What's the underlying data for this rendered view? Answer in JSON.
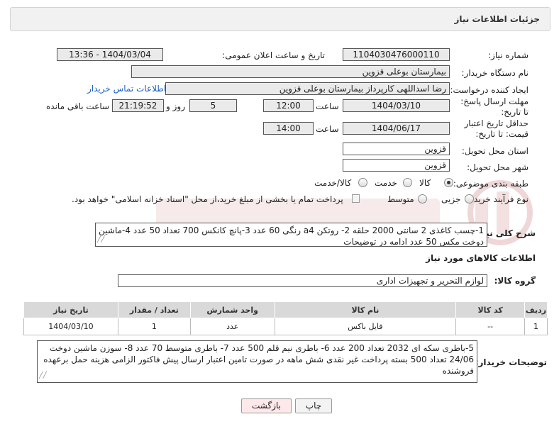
{
  "header": {
    "title": "جزئیات اطلاعات نیاز"
  },
  "form": {
    "need_number_label": "شماره نیاز:",
    "need_number": "1104030476000110",
    "announce_label": "تاریخ و ساعت اعلان عمومی:",
    "announce_value": "1404/03/04 - 13:36",
    "buyer_org_label": "نام دستگاه خریدار:",
    "buyer_org": "بیمارستان بوعلی قزوین",
    "creator_label": "ایجاد کننده درخواست:",
    "creator": "رضا اسداللهی کارپرداز بیمارستان بوعلی قزوین",
    "contact_link": "اطلاعات تماس خریدار",
    "deadline_label": "مهلت ارسال پاسخ: تا تاریخ:",
    "deadline_date": "1404/03/10",
    "hour_label": "ساعت",
    "deadline_time": "12:00",
    "days_value": "5",
    "days_label": "روز و",
    "remaining_time": "21:19:52",
    "remaining_label": "ساعت باقی مانده",
    "validity_label": "حداقل تاریخ اعتبار قیمت: تا تاریخ:",
    "validity_date": "1404/06/17",
    "validity_time": "14:00",
    "province_label": "استان محل تحویل:",
    "province": "قزوین",
    "city_label": "شهر محل تحویل:",
    "city": "قزوین",
    "category_label": "طبقه بندی موضوعی:",
    "category_options": [
      "کالا",
      "خدمت",
      "کالا/خدمت"
    ],
    "purchase_label": "نوع فرآیند خرید :",
    "purchase_options": [
      "جزیی",
      "متوسط"
    ],
    "payment_note": "پرداخت تمام یا بخشی از مبلغ خرید،از محل \"اسناد خزانه اسلامی\" خواهد بود.",
    "description_label": "شرح کلی نیاز:",
    "description": "1-چسب کاغذی 2 سانتی 2000 حلقه 2- روتکن a4 رنگی 60 عدد  3-پانچ کانکس 700 تعداد 50 عدد 4-ماشین دوخت مکس 50 عدد  ادامه در توضیحات"
  },
  "goods": {
    "section_title": "اطلاعات کالاهای مورد نیاز",
    "group_label": "گروه کالا:",
    "group_value": "لوازم التحریر و تجهیزات اداری",
    "columns": [
      "ردیف",
      "کد کالا",
      "نام کالا",
      "واحد شمارش",
      "تعداد / مقدار",
      "تاریخ نیاز"
    ],
    "rows": [
      {
        "row": "1",
        "code": "--",
        "name": "فایل باکس",
        "unit": "عدد",
        "qty": "1",
        "date": "1404/03/10"
      }
    ]
  },
  "notes": {
    "label": "توضیحات خریدار:",
    "text": "5-باطری سکه ای 2032 تعداد 200 عدد 6- باطری نیم قلم 500 عدد 7- باطری متوسط 70 عدد 8- سوزن ماشین دوخت 24/06 تعداد 500 بسته   پرداخت غیر نقدی شش ماهه در صورت تامین اعتبار ارسال پیش فاکتور الزامی هزینه حمل برعهده فروشنده"
  },
  "buttons": {
    "print": "چاپ",
    "back": "بازگشت"
  },
  "colors": {
    "link": "#1f5fbf",
    "back_button": "#fde8ea",
    "header_bg": "#f1f1f1"
  }
}
